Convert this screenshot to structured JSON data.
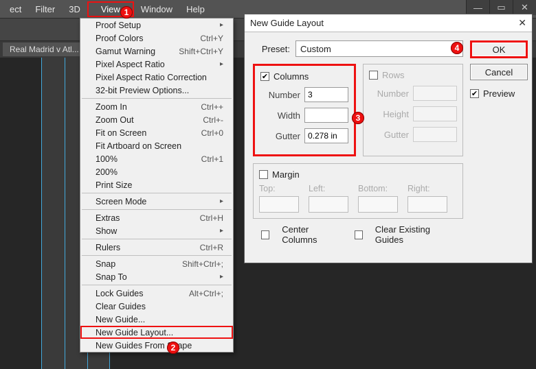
{
  "menubar": {
    "items": [
      "ect",
      "Filter",
      "3D",
      "View",
      "Window",
      "Help"
    ],
    "highlight_index": 3
  },
  "tabrow": {
    "tab": "Real Madrid v Atl..."
  },
  "dropdown": {
    "groups": [
      [
        {
          "label": "Proof Setup",
          "arrow": true
        },
        {
          "label": "Proof Colors",
          "shortcut": "Ctrl+Y"
        },
        {
          "label": "Gamut Warning",
          "shortcut": "Shift+Ctrl+Y"
        },
        {
          "label": "Pixel Aspect Ratio",
          "arrow": true
        },
        {
          "label": "Pixel Aspect Ratio Correction"
        },
        {
          "label": "32-bit Preview Options..."
        }
      ],
      [
        {
          "label": "Zoom In",
          "shortcut": "Ctrl++"
        },
        {
          "label": "Zoom Out",
          "shortcut": "Ctrl+-"
        },
        {
          "label": "Fit on Screen",
          "shortcut": "Ctrl+0"
        },
        {
          "label": "Fit Artboard on Screen"
        },
        {
          "label": "100%",
          "shortcut": "Ctrl+1"
        },
        {
          "label": "200%"
        },
        {
          "label": "Print Size"
        }
      ],
      [
        {
          "label": "Screen Mode",
          "arrow": true
        }
      ],
      [
        {
          "label": "Extras",
          "shortcut": "Ctrl+H"
        },
        {
          "label": "Show",
          "arrow": true
        }
      ],
      [
        {
          "label": "Rulers",
          "shortcut": "Ctrl+R"
        }
      ],
      [
        {
          "label": "Snap",
          "shortcut": "Shift+Ctrl+;"
        },
        {
          "label": "Snap To",
          "arrow": true
        }
      ],
      [
        {
          "label": "Lock Guides",
          "shortcut": "Alt+Ctrl+;"
        },
        {
          "label": "Clear Guides"
        },
        {
          "label": "New Guide..."
        },
        {
          "label": "New Guide Layout...",
          "highlight": true
        },
        {
          "label": "New Guides From Shape"
        }
      ]
    ]
  },
  "dialog": {
    "title": "New Guide Layout",
    "preset_label": "Preset:",
    "preset_value": "Custom",
    "columns": {
      "title": "Columns",
      "checked": true,
      "fields": [
        {
          "label": "Number",
          "value": "3"
        },
        {
          "label": "Width",
          "value": ""
        },
        {
          "label": "Gutter",
          "value": "0.278 in"
        }
      ]
    },
    "rows": {
      "title": "Rows",
      "checked": false,
      "fields": [
        {
          "label": "Number",
          "value": ""
        },
        {
          "label": "Height",
          "value": ""
        },
        {
          "label": "Gutter",
          "value": ""
        }
      ]
    },
    "margin": {
      "title": "Margin",
      "checked": false,
      "fields": [
        "Top:",
        "Left:",
        "Bottom:",
        "Right:"
      ]
    },
    "center_columns": "Center Columns",
    "clear_guides": "Clear Existing Guides",
    "ok": "OK",
    "cancel": "Cancel",
    "preview": "Preview",
    "preview_checked": true
  },
  "badges": {
    "b1": "1",
    "b2": "2",
    "b3": "3",
    "b4": "4"
  }
}
